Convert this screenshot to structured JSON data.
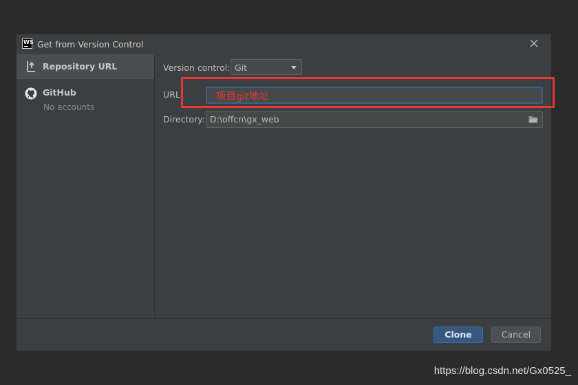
{
  "window": {
    "title": "Get from Version Control",
    "app_icon_text": "WS"
  },
  "sidebar": {
    "items": [
      {
        "label": "Repository URL",
        "icon": "vcs-branch-icon",
        "selected": true
      },
      {
        "label": "GitHub",
        "sublabel": "No accounts",
        "icon": "github-icon",
        "selected": false
      }
    ]
  },
  "form": {
    "version_control_label": "Version control:",
    "version_control_value": "Git",
    "url_label": "URL:",
    "url_value": "项目git地址",
    "directory_label": "Directory:",
    "directory_value": "D:\\offcn\\gx_web"
  },
  "buttons": {
    "clone": "Clone",
    "cancel": "Cancel"
  },
  "watermark": "https://blog.csdn.net/Gx0525_",
  "colors": {
    "accent": "#365880",
    "annotation": "#e53935",
    "background": "#3c3f41"
  }
}
